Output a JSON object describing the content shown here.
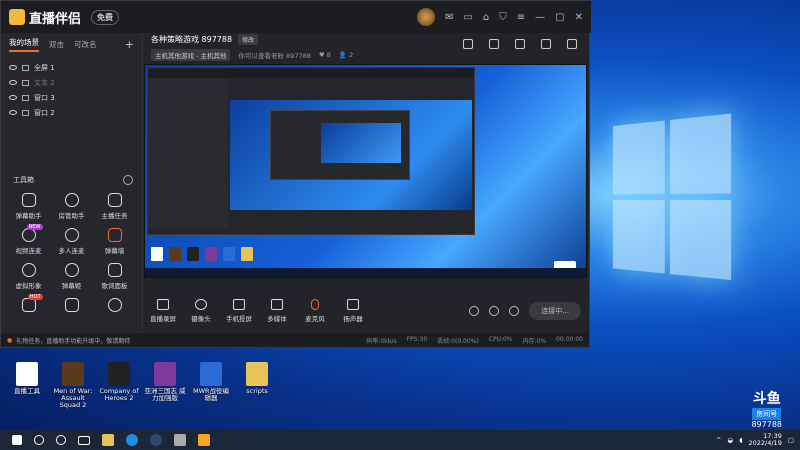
{
  "app": {
    "brand": "直播伴侣",
    "brand_badge": "免费",
    "room_title": "各种策略游戏 897788",
    "edit_label": "修改",
    "category": "主机其他游戏 - 主机其他",
    "room_meta": "你可以查看老粉 897788",
    "likes": "8",
    "viewers": "2"
  },
  "left": {
    "tabs": [
      "我的场景",
      "双击",
      "可改名"
    ],
    "scenes": [
      {
        "label": "全屏 1",
        "dim": false
      },
      {
        "label": "文本 2",
        "dim": true
      },
      {
        "label": "窗口 3",
        "dim": false
      },
      {
        "label": "窗口 2",
        "dim": false
      }
    ],
    "toolbox_label": "工具箱",
    "tools": [
      {
        "label": "弹幕助手",
        "icon": "comment-icon",
        "orange": false
      },
      {
        "label": "房管助手",
        "icon": "user-icon",
        "orange": false
      },
      {
        "label": "主播任务",
        "icon": "task-icon",
        "orange": false
      },
      {
        "label": "视频连麦",
        "icon": "video-icon",
        "orange": false,
        "badge": "NEW"
      },
      {
        "label": "多人连麦",
        "icon": "download-icon",
        "orange": false
      },
      {
        "label": "弹幕墙",
        "icon": "wall-icon",
        "orange": true
      },
      {
        "label": "虚拟形象",
        "icon": "avatar-icon",
        "orange": false
      },
      {
        "label": "弹幕姬",
        "icon": "bell-icon",
        "orange": false
      },
      {
        "label": "歌词面板",
        "icon": "list-icon",
        "orange": false
      },
      {
        "label": "",
        "icon": "hot-icon",
        "orange": false,
        "badge": "HOT"
      },
      {
        "label": "",
        "icon": "puzzle-icon",
        "orange": false
      },
      {
        "label": "",
        "icon": "gamepad-icon",
        "orange": false
      }
    ]
  },
  "controls": [
    {
      "label": "直播录屏",
      "icon": "screen-icon"
    },
    {
      "label": "摄像头",
      "icon": "camera-icon"
    },
    {
      "label": "手机投屏",
      "icon": "phone-icon"
    },
    {
      "label": "多媒体",
      "icon": "media-icon"
    },
    {
      "label": "麦克风",
      "icon": "mic-icon"
    },
    {
      "label": "扬声器",
      "icon": "speaker-icon"
    }
  ],
  "go_live_label": "连接中...",
  "status": {
    "message": "礼物任务，直播助手功能升级中，敬请期待",
    "stats": [
      "码率:0kb/s",
      "FPS:30",
      "丢帧:0(0.00%)",
      "CPU:0%",
      "内存:0%",
      "00:00:00"
    ]
  },
  "desktop_icons": [
    {
      "label": "直播工具",
      "color": "#ffffff"
    },
    {
      "label": "Men of War: Assault Squad 2",
      "color": "#5a3a1a"
    },
    {
      "label": "Company of Heroes 2",
      "color": "#222222"
    },
    {
      "label": "亚洲三国志 威力加强版",
      "color": "#7b3a9c"
    },
    {
      "label": "MWR战役编辑器",
      "color": "#2c6bd6"
    },
    {
      "label": "scripts",
      "color": "#e8c35a"
    }
  ],
  "douyu": {
    "logo": "斗鱼",
    "tag": "房间号",
    "num": "897788"
  },
  "taskbar": {
    "time": "17:39",
    "date": "2022/4/19"
  }
}
